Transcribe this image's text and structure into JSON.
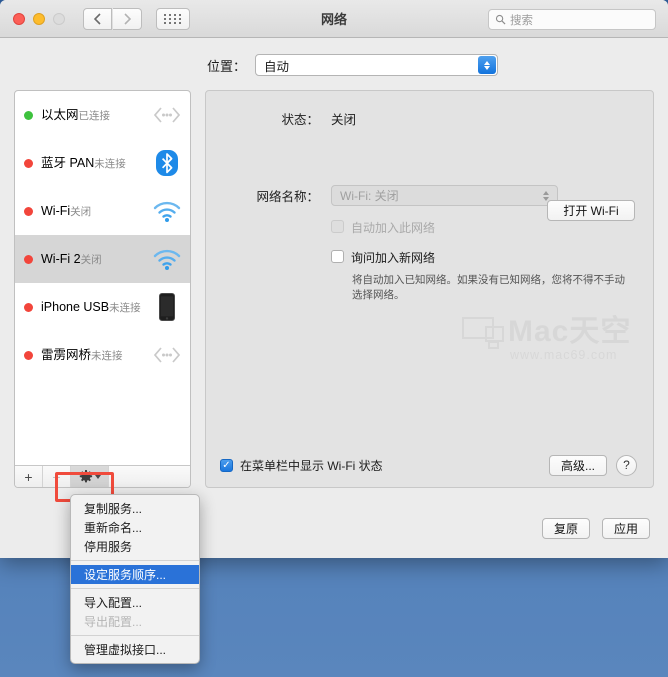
{
  "window": {
    "title": "网络",
    "traffic_lights": [
      "close",
      "minimize",
      "zoom"
    ],
    "nav": {
      "back": "‹",
      "forward": "›",
      "grid": "grid-icon"
    }
  },
  "search": {
    "placeholder": "搜索",
    "value": ""
  },
  "location": {
    "label": "位置：",
    "value": "自动"
  },
  "sidebar": {
    "services": [
      {
        "name": "以太网",
        "state": "已连接",
        "status": "green",
        "icon": "thunderbolt-icon",
        "selected": false
      },
      {
        "name": "蓝牙 PAN",
        "state": "未连接",
        "status": "red",
        "icon": "bluetooth-icon",
        "selected": false
      },
      {
        "name": "Wi-Fi",
        "state": "关闭",
        "status": "red",
        "icon": "wifi-icon",
        "selected": false
      },
      {
        "name": "Wi-Fi 2",
        "state": "关闭",
        "status": "red",
        "icon": "wifi-icon",
        "selected": true
      },
      {
        "name": "iPhone USB",
        "state": "未连接",
        "status": "red",
        "icon": "iphone-icon",
        "selected": false
      },
      {
        "name": "雷雳网桥",
        "state": "未连接",
        "status": "red",
        "icon": "thunderbolt-icon",
        "selected": false
      }
    ],
    "toolbar": {
      "add": "+",
      "remove": "−",
      "gear": "gear-icon"
    }
  },
  "detail": {
    "status_label": "状态：",
    "status_value": "关闭",
    "wifi_toggle": "打开 Wi-Fi",
    "network_name_label": "网络名称：",
    "network_name_value": "Wi-Fi: 关闭",
    "auto_join_label": "自动加入此网络",
    "ask_join_label": "询问加入新网络",
    "hint": "将自动加入已知网络。如果没有已知网络，您将不得不手动选择网络。",
    "menubar_label": "在菜单栏中显示 Wi-Fi 状态",
    "advanced_button": "高级...",
    "help_button": "?"
  },
  "footer": {
    "revert": "复原",
    "apply": "应用"
  },
  "context_menu": {
    "items": [
      {
        "label": "复制服务...",
        "state": "normal"
      },
      {
        "label": "重新命名...",
        "state": "normal"
      },
      {
        "label": "停用服务",
        "state": "normal"
      },
      {
        "label": "",
        "state": "separator"
      },
      {
        "label": "设定服务顺序...",
        "state": "selected"
      },
      {
        "label": "",
        "state": "separator"
      },
      {
        "label": "导入配置...",
        "state": "normal"
      },
      {
        "label": "导出配置...",
        "state": "disabled"
      },
      {
        "label": "",
        "state": "separator"
      },
      {
        "label": "管理虚拟接口...",
        "state": "normal"
      }
    ]
  },
  "watermark": {
    "text": "Mac天空",
    "sub": "www.mac69.com"
  },
  "colors": {
    "accent": "#1a76dd",
    "selection": "#2a72d8",
    "status_ok": "#3ec23e",
    "status_off": "#f2453b",
    "highlight_box": "#f04b3c",
    "desktop": "#4a7ab5"
  }
}
